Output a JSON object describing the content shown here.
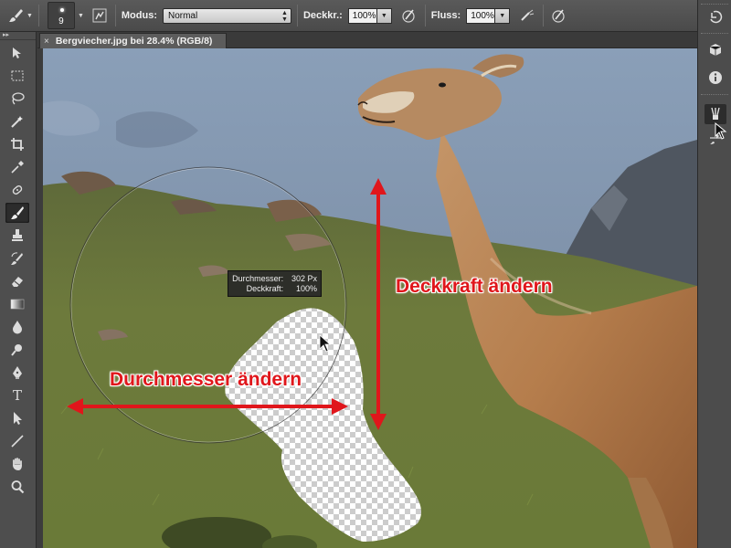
{
  "options_bar": {
    "brush_size": "9",
    "mode_label": "Modus:",
    "mode_value": "Normal",
    "opacity_label": "Deckkr.:",
    "opacity_value": "100%",
    "flow_label": "Fluss:",
    "flow_value": "100%"
  },
  "document": {
    "tab_title": "Bergviecher.jpg bei 28.4% (RGB/8)",
    "close_symbol": "×"
  },
  "hud": {
    "diameter_label": "Durchmesser:",
    "diameter_value": "302 Px",
    "opacity_label": "Deckkraft:",
    "opacity_value": "100%"
  },
  "annotations": {
    "opacity_change": "Deckkraft ändern",
    "diameter_change": "Durchmesser ändern"
  },
  "tools": [
    {
      "name": "move-tool-icon"
    },
    {
      "name": "marquee-tool-icon"
    },
    {
      "name": "lasso-tool-icon"
    },
    {
      "name": "magic-wand-icon"
    },
    {
      "name": "crop-tool-icon"
    },
    {
      "name": "eyedropper-icon"
    },
    {
      "name": "healing-brush-icon"
    },
    {
      "name": "brush-tool-icon"
    },
    {
      "name": "clone-stamp-icon"
    },
    {
      "name": "history-brush-icon"
    },
    {
      "name": "eraser-icon"
    },
    {
      "name": "gradient-tool-icon"
    },
    {
      "name": "blur-tool-icon"
    },
    {
      "name": "dodge-tool-icon"
    },
    {
      "name": "pen-tool-icon"
    },
    {
      "name": "type-tool-icon"
    },
    {
      "name": "path-selection-icon"
    },
    {
      "name": "line-tool-icon"
    },
    {
      "name": "hand-tool-icon"
    },
    {
      "name": "zoom-tool-icon"
    }
  ],
  "type_tool_glyph": "T",
  "colors": {
    "annotation_red": "#e0161b",
    "ui_dark": "#3c3c3c",
    "toolbar_bg": "#4e4e4e"
  }
}
